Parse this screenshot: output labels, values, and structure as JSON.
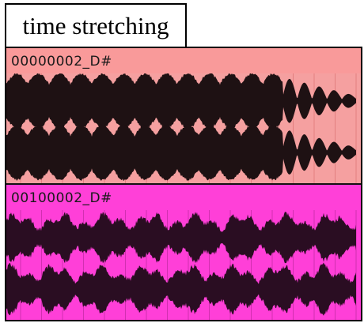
{
  "title": "time stretching",
  "clips": [
    {
      "name": "00000002_D#",
      "header_color": "#f99a9a",
      "body_color": "#f5a0a0",
      "grid_color": "#e27f7f",
      "wave_color": "#1e1113",
      "style": "stretched"
    },
    {
      "name": "00100002_D#",
      "header_color": "#ff40d8",
      "body_color": "#ff3fd8",
      "grid_color": "#d22fb0",
      "wave_color": "#2a0d22",
      "style": "noisy"
    }
  ]
}
